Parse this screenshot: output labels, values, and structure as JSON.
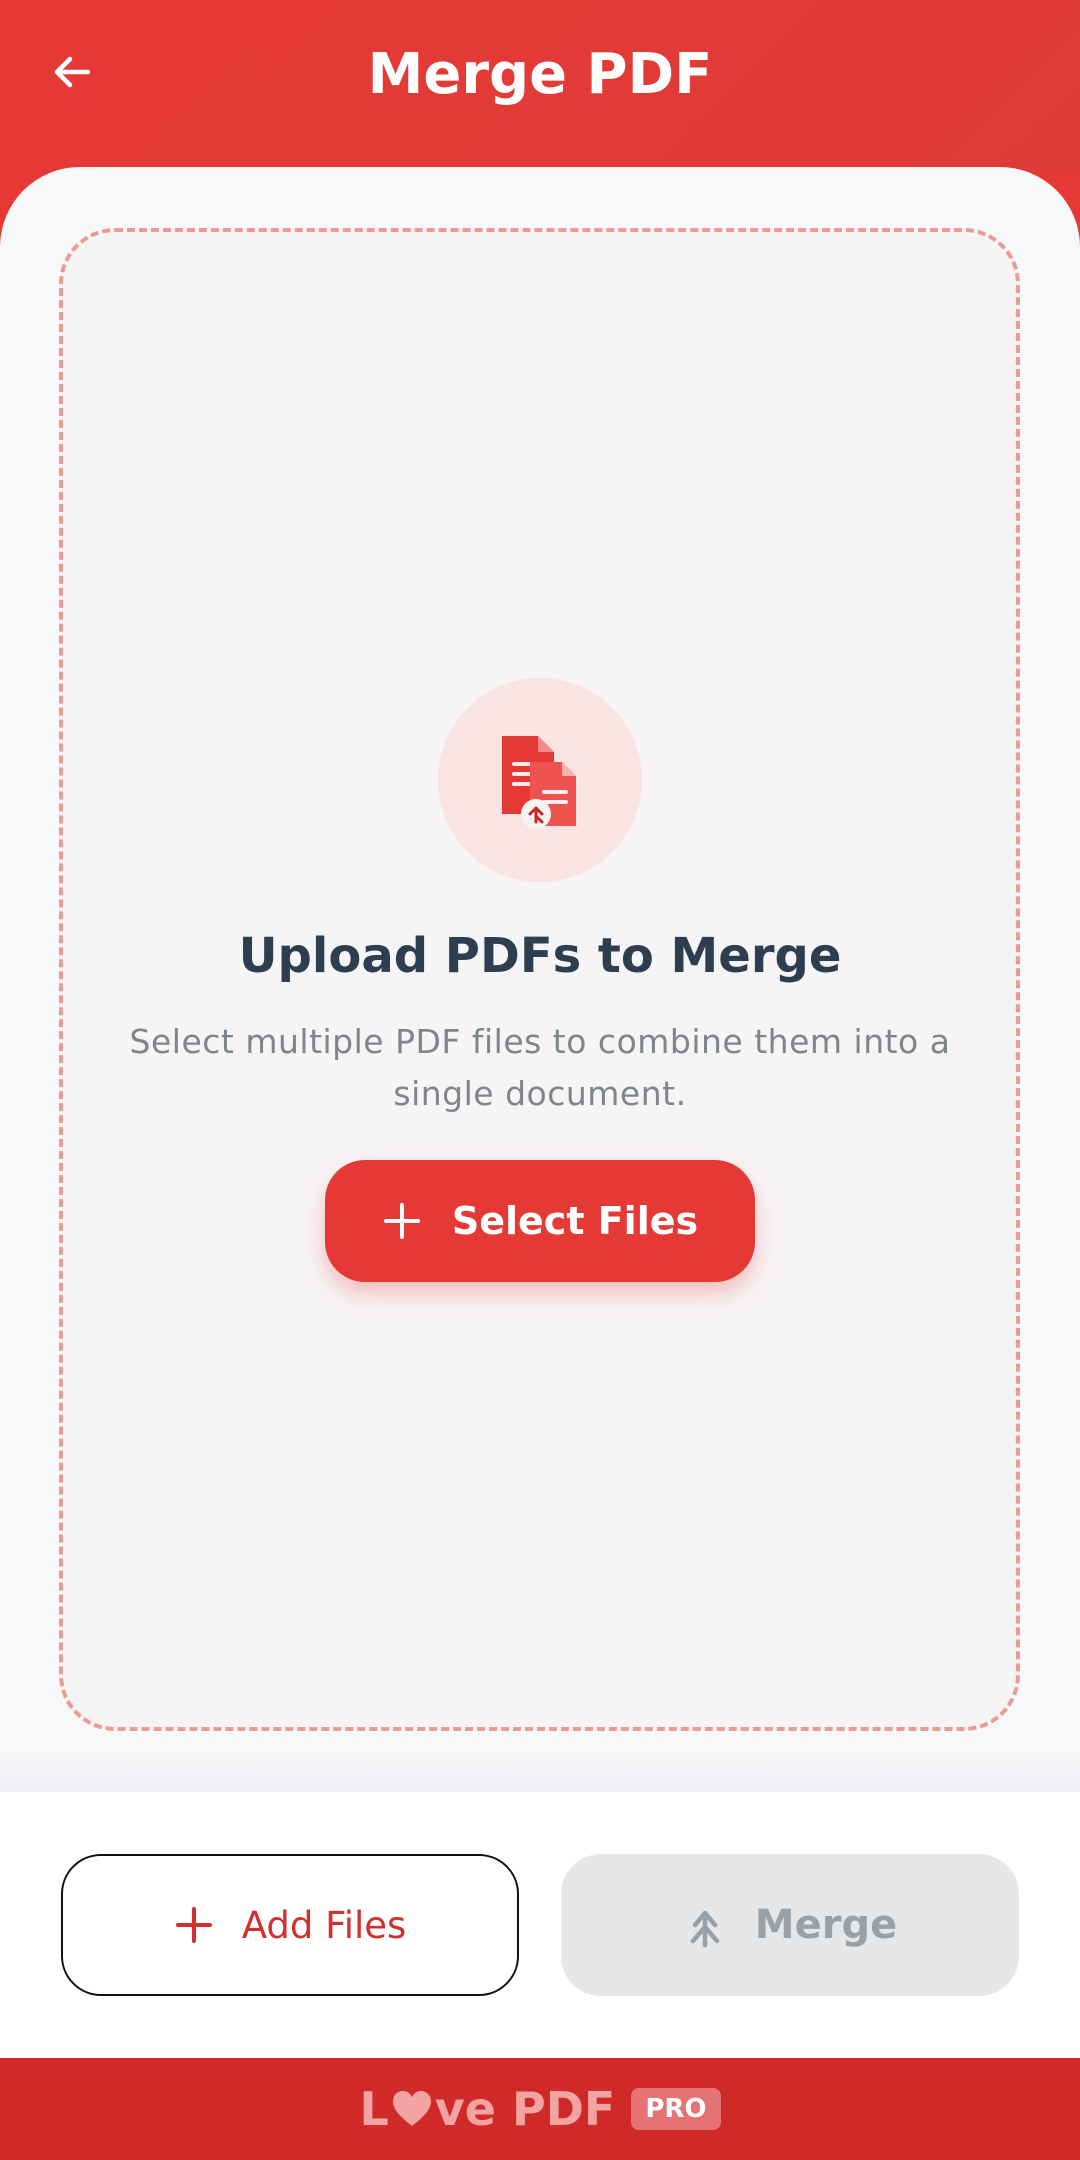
{
  "header": {
    "title": "Merge PDF",
    "back_icon": "arrow-left-icon"
  },
  "dropzone": {
    "icon": "merge-pdf-files-icon",
    "heading": "Upload PDFs to Merge",
    "description": "Select multiple PDF files to combine them into a single document.",
    "select_button": "Select Files"
  },
  "actions": {
    "add_files": "Add Files",
    "merge": "Merge",
    "merge_enabled": false
  },
  "footer": {
    "brand_start": "L",
    "brand_end": "ve PDF",
    "badge": "PRO"
  },
  "colors": {
    "primary": "#e53935",
    "background": "#f7f8fa",
    "disabled": "#e5e7e9",
    "text_dark": "#2c3e50"
  }
}
